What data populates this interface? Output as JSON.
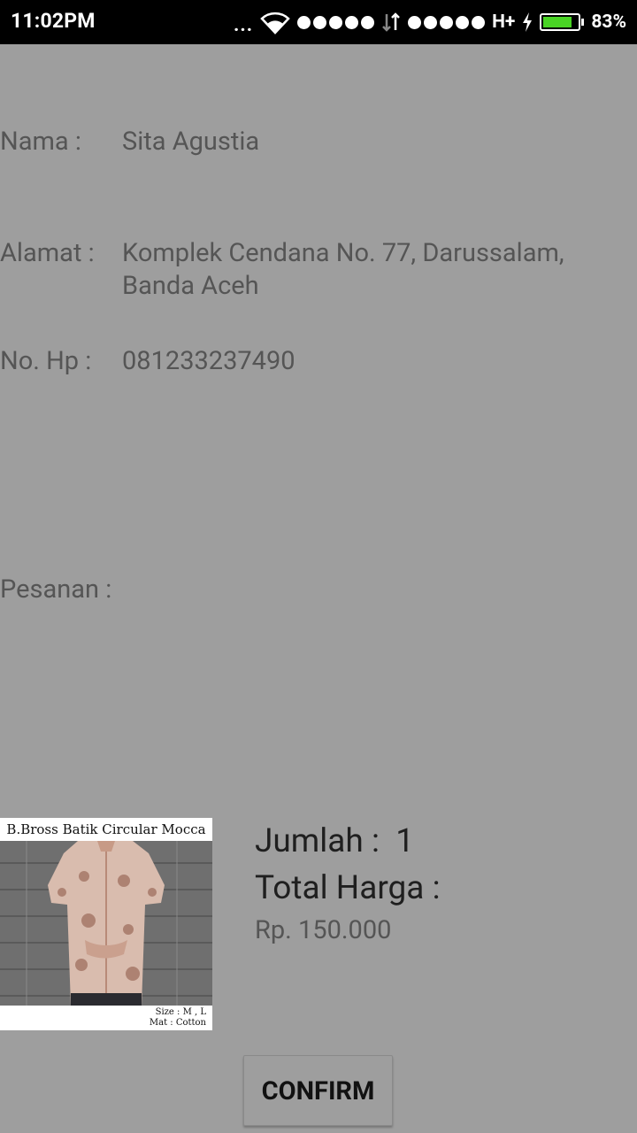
{
  "status_bar": {
    "time": "11:02PM",
    "more": "...",
    "network_type": "H+",
    "battery_percent": "83%",
    "battery_level": 0.83,
    "battery_color": "#49d424"
  },
  "customer": {
    "name_label": "Nama :",
    "name_value": "Sita Agustia",
    "address_label": "Alamat :",
    "address_line1": "Komplek Cendana No. 77, Darussalam,",
    "address_line2": "Banda Aceh",
    "phone_label": "No. Hp :",
    "phone_value": "081233237490"
  },
  "order": {
    "label": "Pesanan :",
    "product_image_title": "B.Bross Batik Circular Mocca",
    "product_size": "Size : M , L",
    "product_material": "Mat : Cotton",
    "quantity_text": "Jumlah :  1",
    "total_label": "Total Harga :",
    "price": "Rp. 150.000"
  },
  "actions": {
    "confirm_label": "CONFIRM"
  },
  "colors": {
    "background": "#9e9e9e",
    "label_text": "#555555",
    "emphasis_text": "#1f1f1f"
  }
}
